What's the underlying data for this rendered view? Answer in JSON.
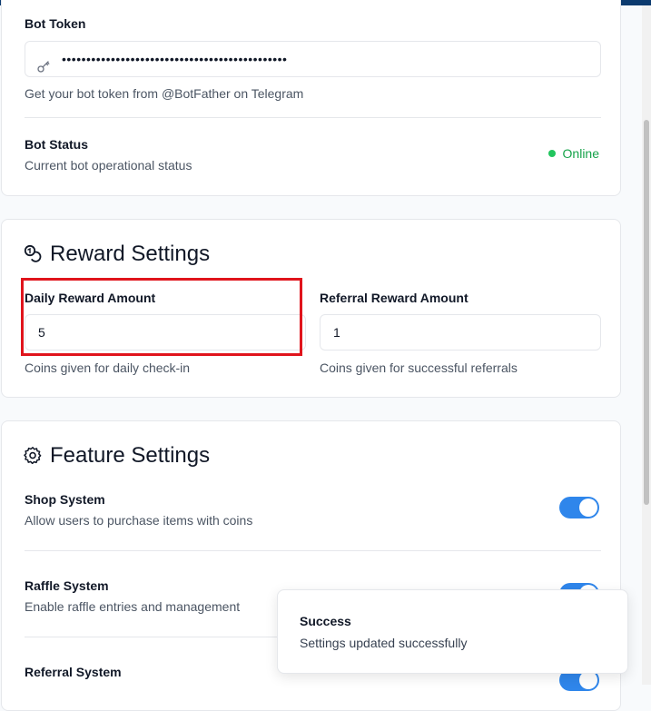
{
  "bot_settings": {
    "token_label": "Bot Token",
    "token_value": "••••••••••••••••••••••••••••••••••••••••••••••",
    "token_hint": "Get your bot token from @BotFather on Telegram",
    "status_label": "Bot Status",
    "status_hint": "Current bot operational status",
    "status_value": "Online",
    "status_color": "#22c55e"
  },
  "reward_settings": {
    "title": "Reward Settings",
    "daily_label": "Daily Reward Amount",
    "daily_value": "5",
    "daily_hint": "Coins given for daily check-in",
    "referral_label": "Referral Reward Amount",
    "referral_value": "1",
    "referral_hint": "Coins given for successful referrals"
  },
  "feature_settings": {
    "title": "Feature Settings",
    "items": [
      {
        "label": "Shop System",
        "hint": "Allow users to purchase items with coins",
        "enabled": true
      },
      {
        "label": "Raffle System",
        "hint": "Enable raffle entries and management",
        "enabled": true
      },
      {
        "label": "Referral System",
        "hint": "",
        "enabled": true
      }
    ]
  },
  "toast": {
    "title": "Success",
    "message": "Settings updated successfully"
  },
  "colors": {
    "accent": "#2f86eb",
    "highlight": "#e0141c",
    "success": "#16a34a"
  }
}
